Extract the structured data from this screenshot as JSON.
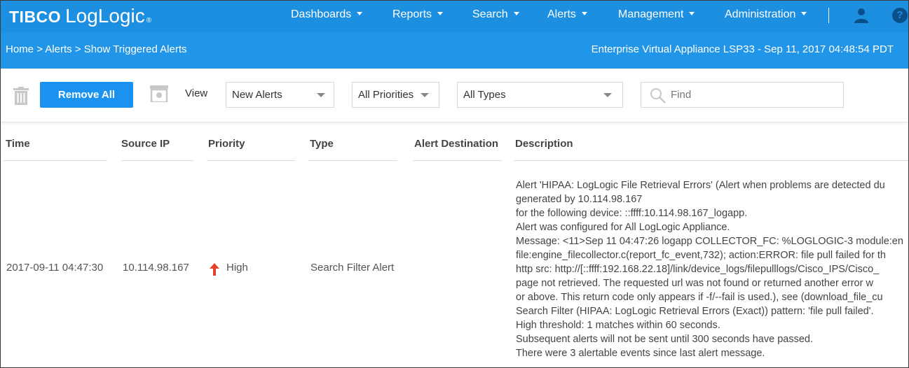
{
  "brand": {
    "company": "TIBCO",
    "product": "LogLogic",
    "reg": "®"
  },
  "nav": {
    "items": [
      {
        "label": "Dashboards",
        "name": "nav-dashboards"
      },
      {
        "label": "Reports",
        "name": "nav-reports"
      },
      {
        "label": "Search",
        "name": "nav-search"
      },
      {
        "label": "Alerts",
        "name": "nav-alerts"
      },
      {
        "label": "Management",
        "name": "nav-management"
      },
      {
        "label": "Administration",
        "name": "nav-administration"
      }
    ],
    "user_icon": "user-icon",
    "help_icon": "help-icon",
    "help_label": "?"
  },
  "breadcrumb": {
    "items": [
      "Home",
      "Alerts",
      "Show Triggered Alerts"
    ],
    "separator": ">",
    "text": "Home > Alerts > Show Triggered Alerts"
  },
  "appliance": "Enterprise Virtual Appliance LSP33 - Sep 11, 2017 04:48:54 PDT",
  "toolbar": {
    "delete_icon": "trash-icon",
    "remove_all_label": "Remove All",
    "archive_icon": "archive-icon",
    "view_label": "View",
    "view_select": "New Alerts",
    "priority_select": "All Priorities",
    "type_select": "All Types",
    "search_placeholder": "Find",
    "search_icon": "search-icon"
  },
  "table": {
    "columns": [
      "Time",
      "Source IP",
      "Priority",
      "Type",
      "Alert Destination",
      "Description"
    ],
    "rows": [
      {
        "time": "2017-09-11 04:47:30",
        "source_ip": "10.114.98.167",
        "priority": "High",
        "priority_icon": "arrow-up-icon",
        "type": "Search Filter Alert",
        "destination": "",
        "description": [
          "Alert 'HIPAA: LogLogic File Retrieval Errors' (Alert when problems are detected du",
          "generated by 10.114.98.167",
          "for the following device: ::ffff:10.114.98.167_logapp.",
          "Alert was configured for All LogLogic Appliance.",
          "Message: <11>Sep 11 04:47:26 logapp COLLECTOR_FC: %LOGLOGIC-3 module:en",
          "file:engine_filecollector.c(report_fc_event,732); action:ERROR: file pull failed for th",
          "http src: http://[::ffff:192.168.22.18]/link/device_logs/filepulllogs/Cisco_IPS/Cisco_",
          "page not retrieved. The requested url was not found or returned another error w",
          "or above. This return code only appears if -f/--fail is used.), see (download_file_cu",
          "Search Filter (HIPAA: LogLogic Retrieval Errors (Exact)) pattern: 'file pull failed'.",
          "High threshold: 1 matches within 60 seconds.",
          "Subsequent alerts will not be sent until 300 seconds have passed.",
          "There were 3 alertable events since last alert message."
        ]
      }
    ]
  },
  "colors": {
    "nav_bg": "#1c8fe0",
    "crumb_bg": "#2196e8",
    "primary_button": "#1a93f0",
    "priority_high": "#e8412c"
  }
}
